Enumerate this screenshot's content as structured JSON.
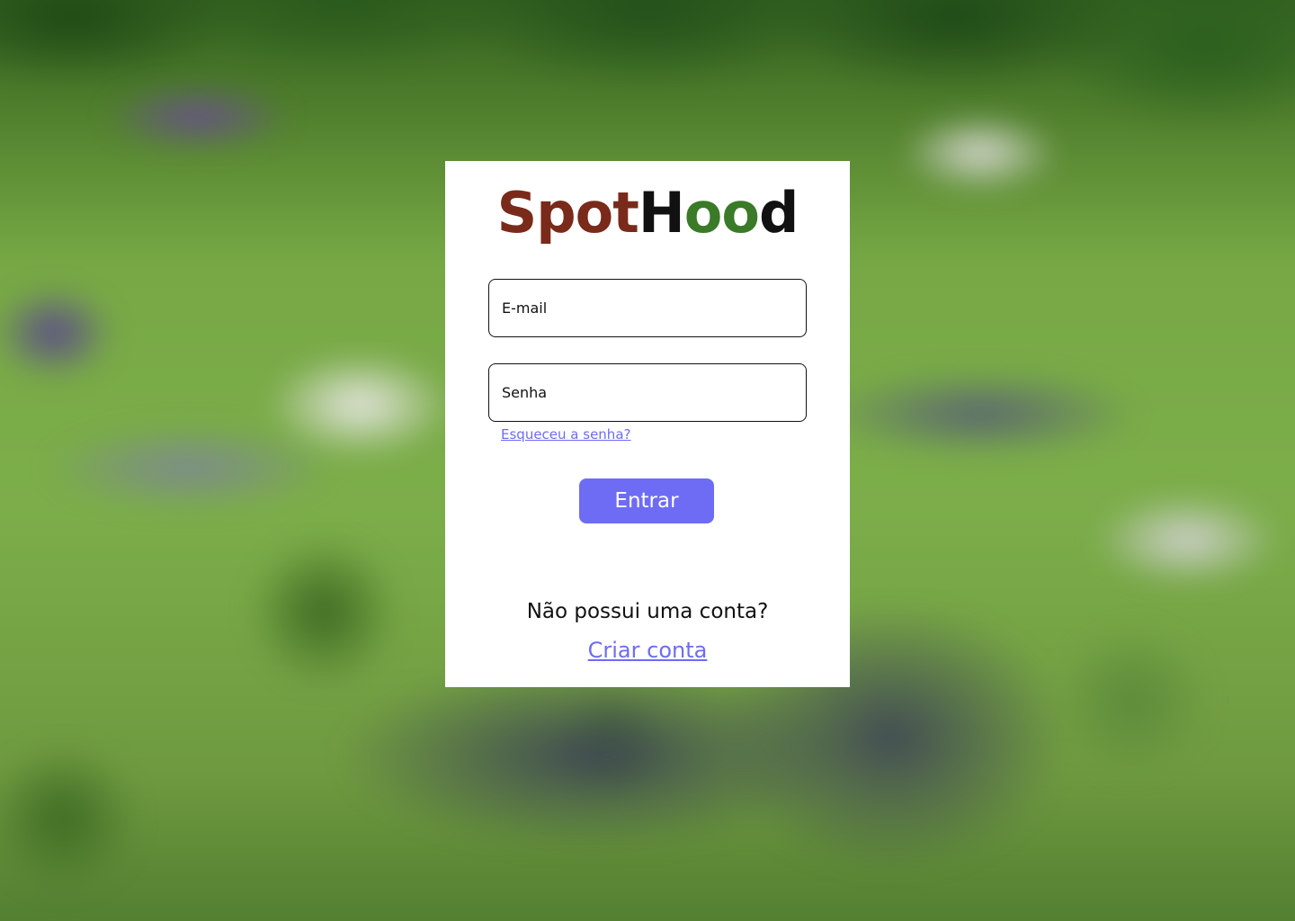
{
  "logo": {
    "part1": "Spot",
    "part2": "H",
    "part3": "oo",
    "part4": "d"
  },
  "form": {
    "email_placeholder": "E-mail",
    "password_placeholder": "Senha",
    "forgot_password": "Esqueceu a senha?",
    "submit_label": "Entrar"
  },
  "signup": {
    "prompt": "Não possui uma conta?",
    "link": "Criar conta"
  },
  "colors": {
    "accent": "#6e6cf5",
    "logo_brown": "#7a2a1a",
    "logo_green": "#3a7a28",
    "logo_dark": "#111111"
  }
}
